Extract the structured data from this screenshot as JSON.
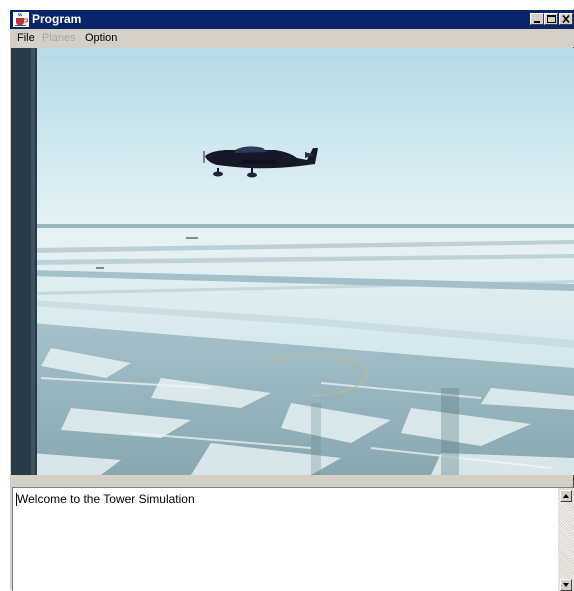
{
  "window": {
    "title": "Program",
    "icon": "java-cup-icon",
    "controls": [
      "minimize-icon",
      "maximize-icon",
      "close-icon"
    ]
  },
  "menu": {
    "items": [
      {
        "label": "File",
        "enabled": true
      },
      {
        "label": "Planes",
        "enabled": false
      },
      {
        "label": "Option",
        "enabled": true
      }
    ]
  },
  "console": {
    "text": "Welcome to the Tower Simulation"
  },
  "colors": {
    "titlebar": "#0a246a",
    "window_face": "#d4d0c8",
    "disabled_text": "#a8a8a8"
  }
}
